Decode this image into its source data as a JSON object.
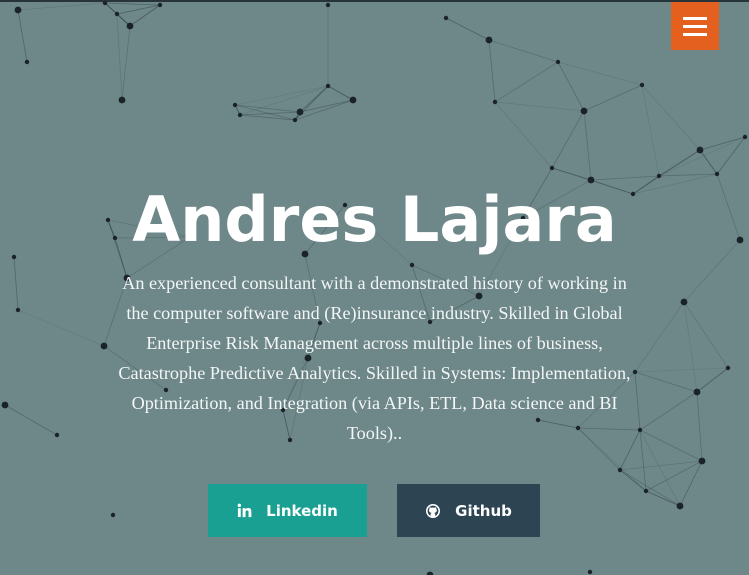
{
  "header": {
    "menu_icon": "hamburger-menu-icon",
    "accent": "#e3601e"
  },
  "hero": {
    "name": "Andres Lajara",
    "description": "An experienced consultant with a demonstrated history of working in the computer software and (Re)insurance industry. Skilled in Global Enterprise Risk Management across multiple lines of business, Catastrophe Predictive Analytics. Skilled in Systems: Implementation, Optimization, and Integration (via APIs, ETL, Data science and BI Tools).."
  },
  "buttons": {
    "linkedin": {
      "label": "Linkedin",
      "icon": "linkedin-icon",
      "color": "#1aa093"
    },
    "github": {
      "label": "Github",
      "icon": "github-icon",
      "color": "#2d4553"
    }
  },
  "colors": {
    "background": "#6e8789"
  }
}
